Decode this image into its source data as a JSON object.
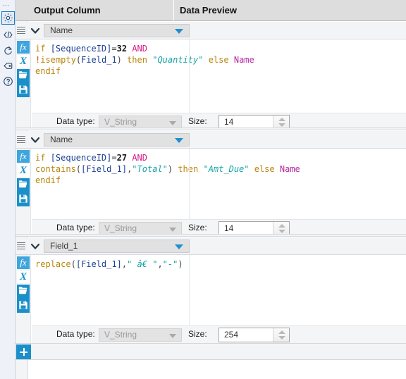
{
  "window": {
    "title": "Alteryx Formula Tool Configuration"
  },
  "rail": {
    "dots": "⋯",
    "items": [
      {
        "name": "gear-icon",
        "label": "Configuration",
        "selected": true
      },
      {
        "name": "code-icon",
        "label": "Annotation"
      },
      {
        "name": "refresh-icon",
        "label": "Run"
      },
      {
        "name": "tag-icon",
        "label": "Comment"
      },
      {
        "name": "help-icon",
        "label": "Help"
      }
    ]
  },
  "header": {
    "output_column": "Output Column",
    "data_preview": "Data Preview"
  },
  "tool_buttons": [
    {
      "name": "fx-button",
      "label": "fx"
    },
    {
      "name": "xvariable-button",
      "label": "X"
    },
    {
      "name": "open-folder-button",
      "label": ""
    },
    {
      "name": "save-button",
      "label": ""
    }
  ],
  "data_type_label": "Data type:",
  "size_label": "Size:",
  "add_row_label": "+",
  "cards": [
    {
      "id": "card-1",
      "output_column": "Name",
      "data_type": "V_String",
      "size": "14",
      "formula_lines": [
        [
          {
            "t": "if ",
            "c": "t-kw"
          },
          {
            "t": "[SequenceID]",
            "c": "t-fld"
          },
          {
            "t": "=",
            "c": "t-punc"
          },
          {
            "t": "32",
            "c": "t-num"
          },
          {
            "t": " ",
            "c": "t-punc"
          },
          {
            "t": "AND",
            "c": "t-op"
          }
        ],
        [
          {
            "t": "!",
            "c": "t-bang"
          },
          {
            "t": "isempty",
            "c": "t-fn"
          },
          {
            "t": "(",
            "c": "t-punc"
          },
          {
            "t": "Field_1",
            "c": "t-fld"
          },
          {
            "t": ") ",
            "c": "t-punc"
          },
          {
            "t": "then",
            "c": "t-kw"
          },
          {
            "t": " ",
            "c": "t-punc"
          },
          {
            "t": "\"Quantity\"",
            "c": "t-str"
          },
          {
            "t": " ",
            "c": "t-punc"
          },
          {
            "t": "else",
            "c": "t-kw"
          },
          {
            "t": " ",
            "c": "t-punc"
          },
          {
            "t": "Name",
            "c": "t-var"
          }
        ],
        [
          {
            "t": "endif",
            "c": "t-kw"
          }
        ]
      ]
    },
    {
      "id": "card-2",
      "output_column": "Name",
      "data_type": "V_String",
      "size": "14",
      "formula_lines": [
        [
          {
            "t": "if ",
            "c": "t-kw"
          },
          {
            "t": "[SequenceID]",
            "c": "t-fld"
          },
          {
            "t": "=",
            "c": "t-punc"
          },
          {
            "t": "27",
            "c": "t-num"
          },
          {
            "t": " ",
            "c": "t-punc"
          },
          {
            "t": "AND",
            "c": "t-op"
          }
        ],
        [
          {
            "t": "contains",
            "c": "t-fn"
          },
          {
            "t": "(",
            "c": "t-punc"
          },
          {
            "t": "[Field_1]",
            "c": "t-fld"
          },
          {
            "t": ",",
            "c": "t-punc"
          },
          {
            "t": "\"Total\"",
            "c": "t-str"
          },
          {
            "t": ") ",
            "c": "t-punc"
          },
          {
            "t": "then",
            "c": "t-kw"
          },
          {
            "t": " ",
            "c": "t-punc"
          },
          {
            "t": "\"Amt_Due\"",
            "c": "t-str"
          },
          {
            "t": " ",
            "c": "t-punc"
          },
          {
            "t": "else",
            "c": "t-kw"
          },
          {
            "t": " ",
            "c": "t-punc"
          },
          {
            "t": "Name",
            "c": "t-var"
          }
        ],
        [
          {
            "t": "endif",
            "c": "t-kw"
          }
        ]
      ]
    },
    {
      "id": "card-3",
      "output_column": "Field_1",
      "data_type": "V_String",
      "size": "254",
      "formula_lines": [
        [
          {
            "t": "replace",
            "c": "t-fn"
          },
          {
            "t": "(",
            "c": "t-punc"
          },
          {
            "t": "[Field_1]",
            "c": "t-fld"
          },
          {
            "t": ",",
            "c": "t-punc"
          },
          {
            "t": "\" â€ \"",
            "c": "t-str"
          },
          {
            "t": ",",
            "c": "t-punc"
          },
          {
            "t": "\"-\"",
            "c": "t-str"
          },
          {
            "t": ")",
            "c": "t-punc"
          }
        ]
      ]
    }
  ],
  "colors": {
    "accent": "#1b8fc9",
    "header_bg": "#dddddd",
    "panel_bg": "#f3f4f6",
    "rail_bg": "#eef2f8",
    "string": "#16a3a3",
    "keyword": "#b8860b",
    "field": "#1c3f94",
    "operator": "#d81b8c",
    "variable": "#b5299b"
  }
}
